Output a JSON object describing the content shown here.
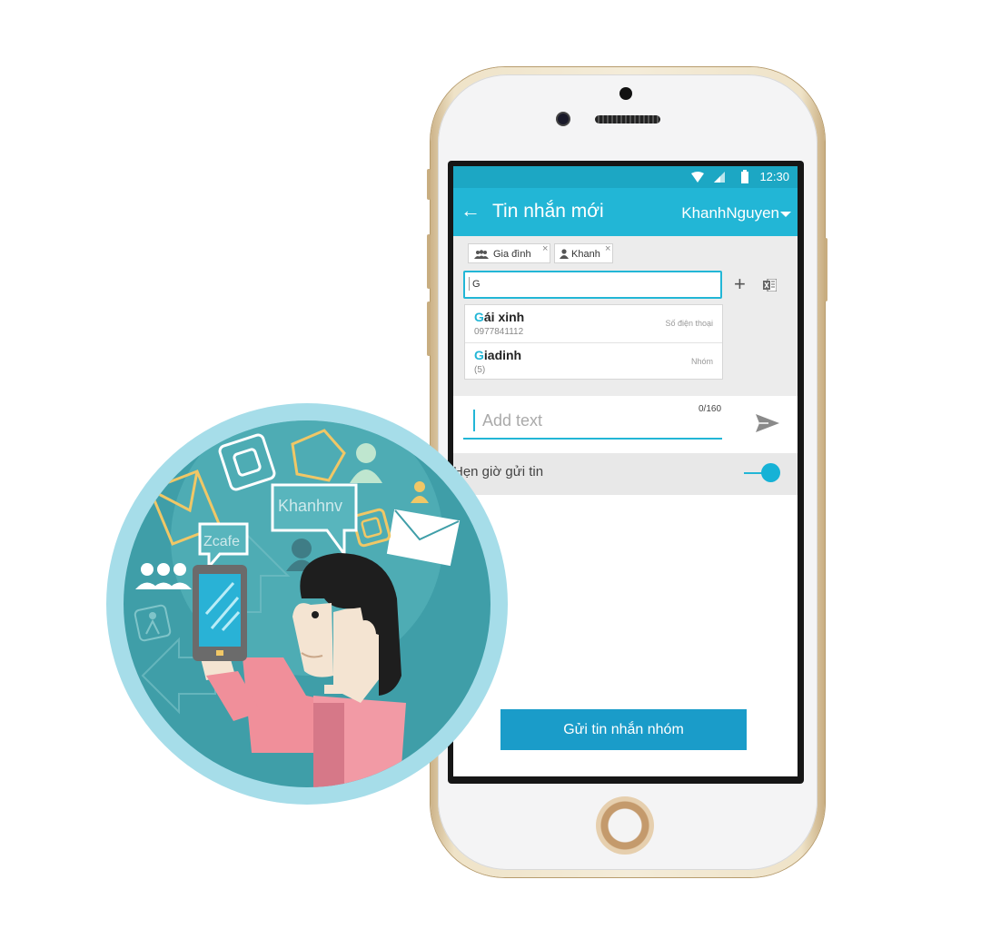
{
  "status_bar": {
    "time": "12:30"
  },
  "app_bar": {
    "title": "Tin nhắn mới",
    "account": "KhanhNguyen"
  },
  "recipients": [
    {
      "label": "Gia đình",
      "icon": "group-icon"
    },
    {
      "label": "Khanh",
      "icon": "person-icon"
    }
  ],
  "search": {
    "value": "G"
  },
  "suggestions": [
    {
      "highlight": "G",
      "rest": "ái xinh",
      "sub": "0977841112",
      "type": "Số điện thoại"
    },
    {
      "highlight": "G",
      "rest": "iadinh",
      "sub": "(5)",
      "type": "Nhóm"
    }
  ],
  "compose": {
    "placeholder": "Add text",
    "counter": "0/160"
  },
  "schedule": {
    "label": "Hẹn giờ gửi tin",
    "enabled": true
  },
  "send_button": {
    "label": "Gửi tin nhắn nhóm"
  },
  "illustration": {
    "bubble_1": "Khanhnv",
    "bubble_2": "Zcafe"
  },
  "colors": {
    "accent": "#22b6d6",
    "status_bar": "#1ca7c4",
    "button": "#1a9cc9",
    "illustration_ring": "#a6dde9",
    "illustration_bg": "#3f9ea8"
  }
}
